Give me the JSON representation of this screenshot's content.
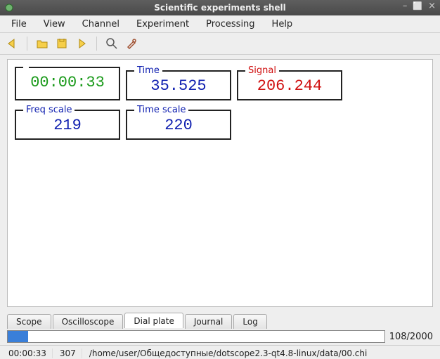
{
  "window": {
    "title": "Scientific experiments shell"
  },
  "menu": {
    "file": "File",
    "view": "View",
    "channel": "Channel",
    "experiment": "Experiment",
    "processing": "Processing",
    "help": "Help"
  },
  "readouts": {
    "clock": {
      "label": "",
      "value": "00:00:33"
    },
    "time": {
      "label": "Time",
      "value": "35.525"
    },
    "signal": {
      "label": "Signal",
      "value": "206.244"
    },
    "freq_scale": {
      "label": "Freq scale",
      "value": "219"
    },
    "time_scale": {
      "label": "Time scale",
      "value": "220"
    }
  },
  "tabs": {
    "scope": "Scope",
    "oscilloscope": "Oscilloscope",
    "dial_plate": "Dial plate",
    "journal": "Journal",
    "log": "Log"
  },
  "progress": {
    "text": "108/2000"
  },
  "status": {
    "time": "00:00:33",
    "frame": "307",
    "path": "/home/user/Общедоступные/dotscope2.3-qt4.8-linux/data/00.chi"
  }
}
